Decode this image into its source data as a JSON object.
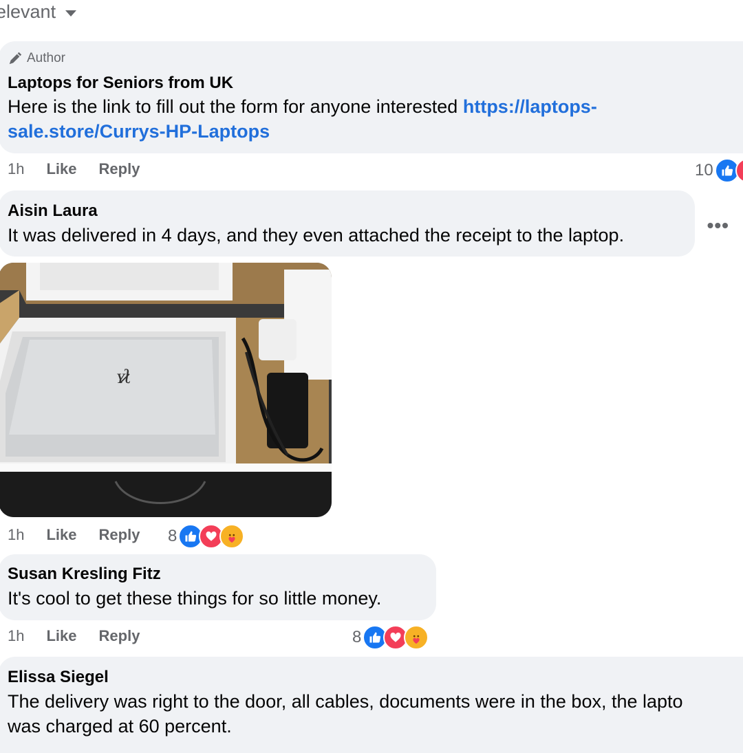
{
  "sort": {
    "label": "elevant"
  },
  "comments": [
    {
      "badge": "Author",
      "name": "Laptops for Seniors from UK",
      "text_before": "Here is the link to fill out the form for anyone interested ",
      "link_line1": "https://laptops-",
      "link_line2": "sale.store/Currys-HP-Laptops",
      "time": "1h",
      "like": "Like",
      "reply": "Reply",
      "reaction_count": "10"
    },
    {
      "name": "Aisin Laura",
      "text": "It was delivered in 4 days, and they even attached the receipt to the laptop.",
      "more": "•••",
      "time": "1h",
      "like": "Like",
      "reply": "Reply",
      "reaction_count": "8",
      "photo_logo": "ʏ̷̷ʅ"
    },
    {
      "name": "Susan Kresling Fitz",
      "text": "It's cool to get these things for so little money.",
      "time": "1h",
      "like": "Like",
      "reply": "Reply",
      "reaction_count": "8"
    },
    {
      "name": "Elissa Siegel",
      "line1": "The delivery was right to the door, all cables, documents were in the box, the lapto",
      "line2": "was charged at 60 percent."
    }
  ],
  "colors": {
    "bubble": "#f0f2f5",
    "link": "#216fdb",
    "like": "#1877f2",
    "love": "#f33e58",
    "care": "#f7b125",
    "meta": "#65676b"
  },
  "icons": [
    "pen-icon",
    "caret-down-icon",
    "like-reaction-icon",
    "love-reaction-icon",
    "care-reaction-icon",
    "more-options-icon"
  ]
}
